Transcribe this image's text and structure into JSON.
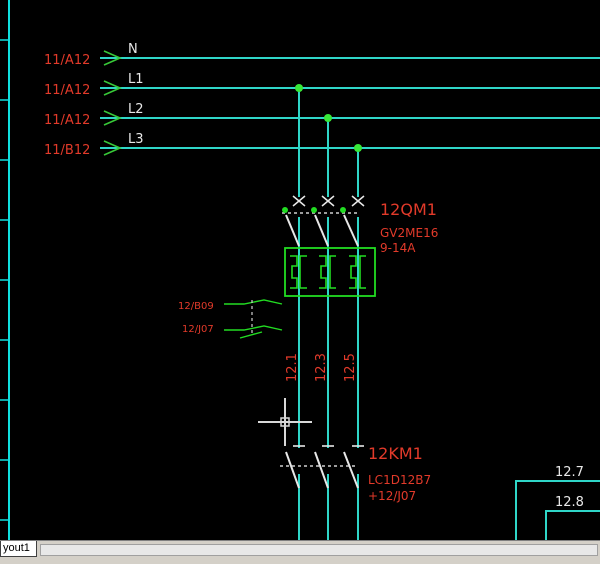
{
  "incoming": [
    {
      "ref": "11/A12",
      "line": "N"
    },
    {
      "ref": "11/A12",
      "line": "L1"
    },
    {
      "ref": "11/A12",
      "line": "L2"
    },
    {
      "ref": "11/B12",
      "line": "L3"
    }
  ],
  "breaker": {
    "tag": "12QM1",
    "model": "GV2ME16",
    "range": "9-14A"
  },
  "aux_refs": [
    "12/B09",
    "12/J07"
  ],
  "wires": [
    "12.1",
    "12.3",
    "12.5"
  ],
  "contactor": {
    "tag": "12KM1",
    "model": "LC1D12B7",
    "ref": "+12/J07"
  },
  "right_labels": [
    "12.7",
    "12.8"
  ],
  "tab": {
    "label": "yout1"
  },
  "colors": {
    "wire": "#2fd6c8",
    "label_red": "#e23a2a",
    "arrow": "#38c838",
    "component": "#22dd22",
    "frame": "#10e0e0"
  }
}
